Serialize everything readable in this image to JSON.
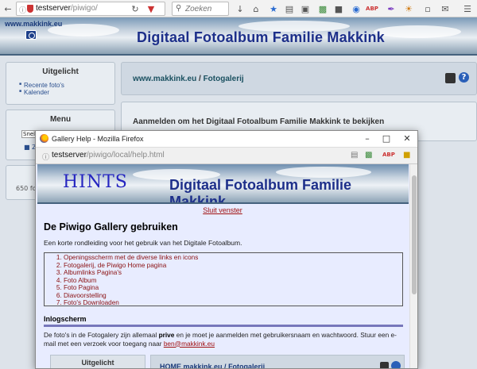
{
  "browser": {
    "url_host": "testserver",
    "url_path": "/piwigo/",
    "search_placeholder": "Zoeken"
  },
  "site": {
    "link": "www.makkink.eu",
    "banner_title": "Digitaal Fotoalbum Familie Makkink"
  },
  "sidebar": {
    "uitgelicht_title": "Uitgelicht",
    "uitgelicht_items": [
      "Recente foto's",
      "Kalender"
    ],
    "menu_title": "Menu",
    "menu_select": "Snel",
    "zoe_label": "Zoe",
    "photo_count": "650 fo"
  },
  "main": {
    "breadcrumb_site": "www.makkink.eu",
    "breadcrumb_sep": " / ",
    "breadcrumb_page": "Fotogalerij",
    "login_message": "Aanmelden om het Digitaal Fotoalbum Familie Makkink te bekijken"
  },
  "popup": {
    "window_title": "Gallery Help - Mozilla Firefox",
    "url_host": "testserver",
    "url_path": "/piwigo/local/help.html",
    "hints_label": "HINTS",
    "banner_title": "Digitaal Fotoalbum Familie Makkink",
    "close_link": "Sluit venster",
    "heading": "De Piwigo Gallery gebruiken",
    "intro": "Een korte rondleiding voor het gebruik van het Digitale Fotoalbum.",
    "toc": [
      "Openingsscherm met de diverse links en icons",
      "Fotogalerij, de Piwigo Home pagina",
      "Albumlinks Pagina's",
      "Foto Album",
      "Foto Pagina",
      "Diavoorstelling",
      "Foto's Downloaden"
    ],
    "section_heading": "Inlogscherm",
    "para_part1": "De foto's in de Fotogalery zijn allemaal ",
    "para_bold": "prive",
    "para_part2": " en je moet je aanmelden met gebruikersnaam en wachtwoord. Stuur een e-mail met een verzoek voor toegang naar ",
    "para_email": "ben@makkink.eu",
    "mini_uitgelicht": "Uitgelicht",
    "mini_nav_home": "HOME",
    "mini_nav_site": "makkink.eu",
    "mini_nav_sep": " / ",
    "mini_nav_page": "Fotogalerij"
  },
  "colors": {
    "banner_title": "#1d2f8a",
    "link_red": "#a01010",
    "help_bg": "#e8ecff"
  }
}
